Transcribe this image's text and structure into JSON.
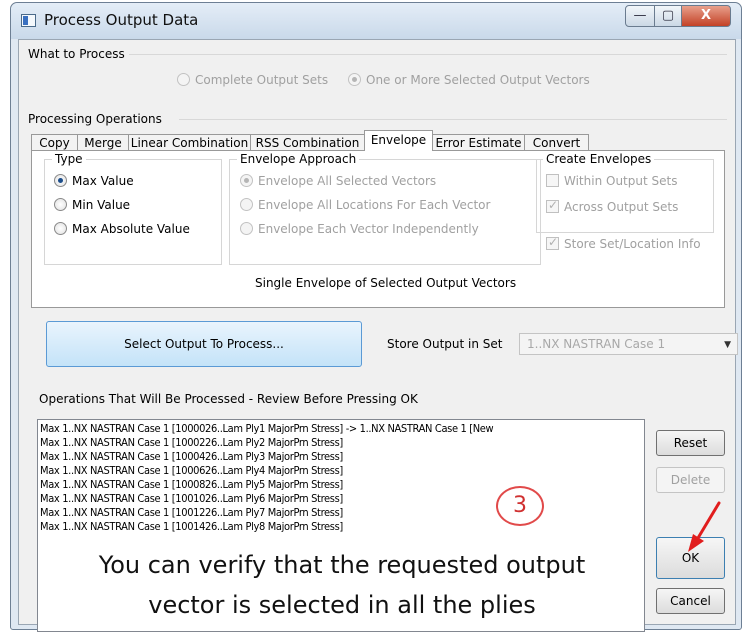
{
  "window": {
    "title": "Process Output Data",
    "controls": {
      "minimize": "—",
      "maximize": "▢",
      "close": "X"
    }
  },
  "what_to_process": {
    "label": "What to Process",
    "options": [
      {
        "label": "Complete Output Sets",
        "selected": false
      },
      {
        "label": "One or More Selected Output Vectors",
        "selected": true
      }
    ]
  },
  "processing_operations": {
    "label": "Processing Operations",
    "tabs": [
      "Copy",
      "Merge",
      "Linear Combination",
      "RSS Combination",
      "Envelope",
      "Error Estimate",
      "Convert"
    ],
    "active_tab": "Envelope"
  },
  "envelope": {
    "type": {
      "label": "Type",
      "options": [
        {
          "label": "Max Value",
          "selected": true
        },
        {
          "label": "Min Value",
          "selected": false
        },
        {
          "label": "Max Absolute Value",
          "selected": false
        }
      ]
    },
    "approach": {
      "label": "Envelope Approach",
      "options": [
        {
          "label": "Envelope All Selected Vectors",
          "selected": true
        },
        {
          "label": "Envelope All Locations For Each Vector",
          "selected": false
        },
        {
          "label": "Envelope Each Vector Independently",
          "selected": false
        }
      ]
    },
    "create": {
      "label": "Create Envelopes",
      "options": [
        {
          "label": "Within Output Sets",
          "checked": false
        },
        {
          "label": "Across Output Sets",
          "checked": true
        },
        {
          "label": "Store Set/Location Info",
          "checked": true
        }
      ]
    },
    "summary": "Single Envelope of Selected Output Vectors"
  },
  "select_output_button": "Select Output To Process...",
  "store_output": {
    "label": "Store Output in Set",
    "value": "1..NX NASTRAN Case 1"
  },
  "operations": {
    "label": "Operations That Will Be Processed - Review Before Pressing OK",
    "rows": [
      "Max 1..NX NASTRAN Case 1 [1000026..Lam Ply1 MajorPrn Stress] -> 1..NX NASTRAN Case 1 [New",
      "Max 1..NX NASTRAN Case 1 [1000226..Lam Ply2 MajorPrn Stress]",
      "Max 1..NX NASTRAN Case 1 [1000426..Lam Ply3 MajorPrn Stress]",
      "Max 1..NX NASTRAN Case 1 [1000626..Lam Ply4 MajorPrn Stress]",
      "Max 1..NX NASTRAN Case 1 [1000826..Lam Ply5 MajorPrn Stress]",
      "Max 1..NX NASTRAN Case 1 [1001026..Lam Ply6 MajorPrn Stress]",
      "Max 1..NX NASTRAN Case 1 [1001226..Lam Ply7 MajorPrn Stress]",
      "Max 1..NX NASTRAN Case 1 [1001426..Lam Ply8 MajorPrn Stress]"
    ]
  },
  "buttons": {
    "reset": "Reset",
    "delete": "Delete",
    "ok": "OK",
    "cancel": "Cancel"
  },
  "annotation": {
    "step": "3",
    "line1": "You can verify that the requested output",
    "line2": "vector is selected in all the plies",
    "color": "#e14a4a"
  }
}
